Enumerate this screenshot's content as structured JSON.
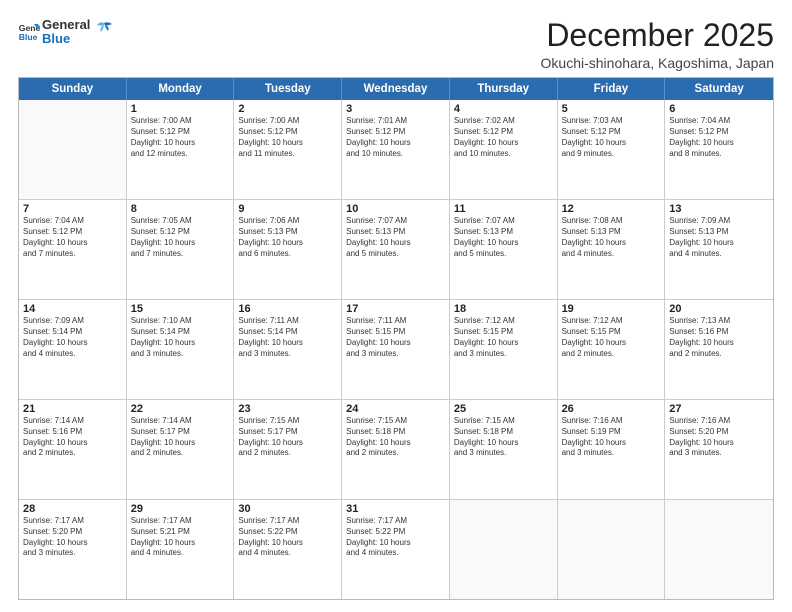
{
  "logo": {
    "line1": "General",
    "line2": "Blue"
  },
  "header": {
    "title": "December 2025",
    "location": "Okuchi-shinohara, Kagoshima, Japan"
  },
  "weekdays": [
    "Sunday",
    "Monday",
    "Tuesday",
    "Wednesday",
    "Thursday",
    "Friday",
    "Saturday"
  ],
  "rows": [
    [
      {
        "day": "",
        "info": ""
      },
      {
        "day": "1",
        "info": "Sunrise: 7:00 AM\nSunset: 5:12 PM\nDaylight: 10 hours\nand 12 minutes."
      },
      {
        "day": "2",
        "info": "Sunrise: 7:00 AM\nSunset: 5:12 PM\nDaylight: 10 hours\nand 11 minutes."
      },
      {
        "day": "3",
        "info": "Sunrise: 7:01 AM\nSunset: 5:12 PM\nDaylight: 10 hours\nand 10 minutes."
      },
      {
        "day": "4",
        "info": "Sunrise: 7:02 AM\nSunset: 5:12 PM\nDaylight: 10 hours\nand 10 minutes."
      },
      {
        "day": "5",
        "info": "Sunrise: 7:03 AM\nSunset: 5:12 PM\nDaylight: 10 hours\nand 9 minutes."
      },
      {
        "day": "6",
        "info": "Sunrise: 7:04 AM\nSunset: 5:12 PM\nDaylight: 10 hours\nand 8 minutes."
      }
    ],
    [
      {
        "day": "7",
        "info": "Sunrise: 7:04 AM\nSunset: 5:12 PM\nDaylight: 10 hours\nand 7 minutes."
      },
      {
        "day": "8",
        "info": "Sunrise: 7:05 AM\nSunset: 5:12 PM\nDaylight: 10 hours\nand 7 minutes."
      },
      {
        "day": "9",
        "info": "Sunrise: 7:06 AM\nSunset: 5:13 PM\nDaylight: 10 hours\nand 6 minutes."
      },
      {
        "day": "10",
        "info": "Sunrise: 7:07 AM\nSunset: 5:13 PM\nDaylight: 10 hours\nand 5 minutes."
      },
      {
        "day": "11",
        "info": "Sunrise: 7:07 AM\nSunset: 5:13 PM\nDaylight: 10 hours\nand 5 minutes."
      },
      {
        "day": "12",
        "info": "Sunrise: 7:08 AM\nSunset: 5:13 PM\nDaylight: 10 hours\nand 4 minutes."
      },
      {
        "day": "13",
        "info": "Sunrise: 7:09 AM\nSunset: 5:13 PM\nDaylight: 10 hours\nand 4 minutes."
      }
    ],
    [
      {
        "day": "14",
        "info": "Sunrise: 7:09 AM\nSunset: 5:14 PM\nDaylight: 10 hours\nand 4 minutes."
      },
      {
        "day": "15",
        "info": "Sunrise: 7:10 AM\nSunset: 5:14 PM\nDaylight: 10 hours\nand 3 minutes."
      },
      {
        "day": "16",
        "info": "Sunrise: 7:11 AM\nSunset: 5:14 PM\nDaylight: 10 hours\nand 3 minutes."
      },
      {
        "day": "17",
        "info": "Sunrise: 7:11 AM\nSunset: 5:15 PM\nDaylight: 10 hours\nand 3 minutes."
      },
      {
        "day": "18",
        "info": "Sunrise: 7:12 AM\nSunset: 5:15 PM\nDaylight: 10 hours\nand 3 minutes."
      },
      {
        "day": "19",
        "info": "Sunrise: 7:12 AM\nSunset: 5:15 PM\nDaylight: 10 hours\nand 2 minutes."
      },
      {
        "day": "20",
        "info": "Sunrise: 7:13 AM\nSunset: 5:16 PM\nDaylight: 10 hours\nand 2 minutes."
      }
    ],
    [
      {
        "day": "21",
        "info": "Sunrise: 7:14 AM\nSunset: 5:16 PM\nDaylight: 10 hours\nand 2 minutes."
      },
      {
        "day": "22",
        "info": "Sunrise: 7:14 AM\nSunset: 5:17 PM\nDaylight: 10 hours\nand 2 minutes."
      },
      {
        "day": "23",
        "info": "Sunrise: 7:15 AM\nSunset: 5:17 PM\nDaylight: 10 hours\nand 2 minutes."
      },
      {
        "day": "24",
        "info": "Sunrise: 7:15 AM\nSunset: 5:18 PM\nDaylight: 10 hours\nand 2 minutes."
      },
      {
        "day": "25",
        "info": "Sunrise: 7:15 AM\nSunset: 5:18 PM\nDaylight: 10 hours\nand 3 minutes."
      },
      {
        "day": "26",
        "info": "Sunrise: 7:16 AM\nSunset: 5:19 PM\nDaylight: 10 hours\nand 3 minutes."
      },
      {
        "day": "27",
        "info": "Sunrise: 7:16 AM\nSunset: 5:20 PM\nDaylight: 10 hours\nand 3 minutes."
      }
    ],
    [
      {
        "day": "28",
        "info": "Sunrise: 7:17 AM\nSunset: 5:20 PM\nDaylight: 10 hours\nand 3 minutes."
      },
      {
        "day": "29",
        "info": "Sunrise: 7:17 AM\nSunset: 5:21 PM\nDaylight: 10 hours\nand 4 minutes."
      },
      {
        "day": "30",
        "info": "Sunrise: 7:17 AM\nSunset: 5:22 PM\nDaylight: 10 hours\nand 4 minutes."
      },
      {
        "day": "31",
        "info": "Sunrise: 7:17 AM\nSunset: 5:22 PM\nDaylight: 10 hours\nand 4 minutes."
      },
      {
        "day": "",
        "info": ""
      },
      {
        "day": "",
        "info": ""
      },
      {
        "day": "",
        "info": ""
      }
    ]
  ]
}
